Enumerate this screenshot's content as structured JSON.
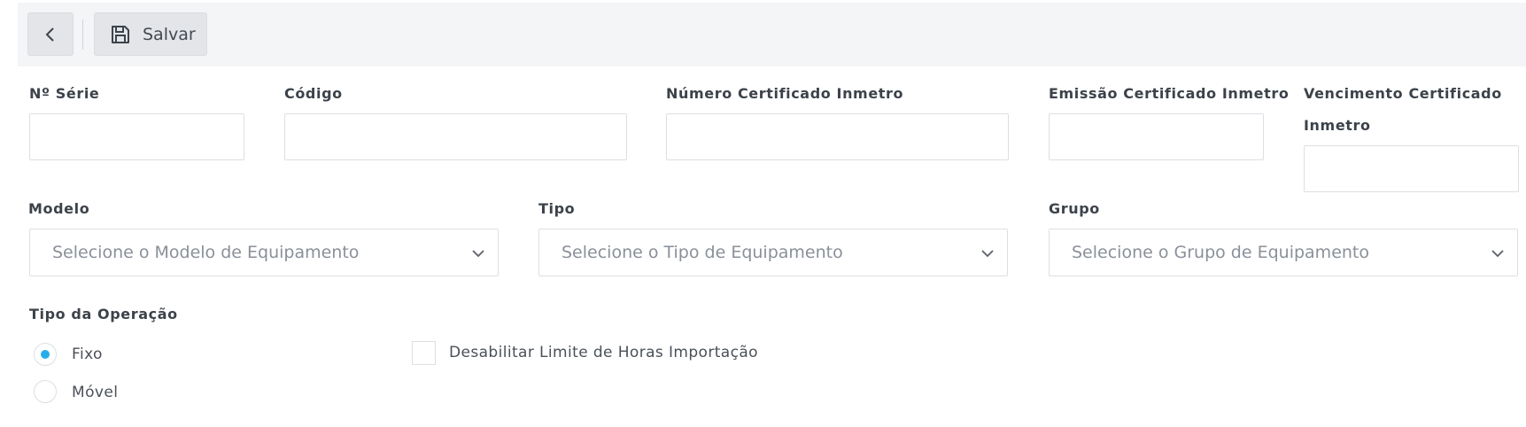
{
  "toolbar": {
    "back_icon": "chevron-left-icon",
    "save_icon": "floppy-disk-icon",
    "save_label": "Salvar"
  },
  "fields": {
    "serie": {
      "label": "Nº Série",
      "value": ""
    },
    "codigo": {
      "label": "Código",
      "value": ""
    },
    "numero_cert": {
      "label": "Número Certificado Inmetro",
      "value": ""
    },
    "emissao_cert": {
      "label": "Emissão Certificado Inmetro",
      "value": ""
    },
    "vencimento_cert": {
      "label_line1": "Vencimento Certificado",
      "label_line2": "Inmetro",
      "value": ""
    }
  },
  "selects": {
    "modelo": {
      "label": "Modelo",
      "placeholder": "Selecione o Modelo de Equipamento"
    },
    "tipo": {
      "label": "Tipo",
      "placeholder": "Selecione o Tipo de Equipamento"
    },
    "grupo": {
      "label": "Grupo",
      "placeholder": "Selecione o Grupo de Equipamento"
    }
  },
  "operacao": {
    "label": "Tipo da Operação",
    "options": [
      {
        "label": "Fixo",
        "selected": true
      },
      {
        "label": "Móvel",
        "selected": false
      }
    ]
  },
  "checkbox": {
    "label": "Desabilitar Limite de Horas Importação",
    "checked": false
  },
  "colors": {
    "accent": "#27aee8",
    "toolbar_bg": "#f4f5f7",
    "border": "#dcdfe3"
  }
}
